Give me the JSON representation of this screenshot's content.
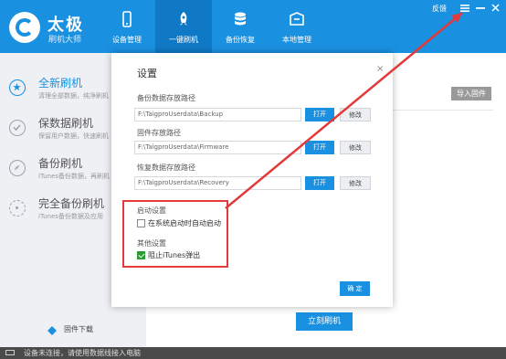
{
  "app": {
    "logo_title": "太极",
    "logo_sub": "刷机大师"
  },
  "nav": [
    {
      "label": "设备管理",
      "icon": "phone-icon"
    },
    {
      "label": "一键刷机",
      "icon": "rocket-icon"
    },
    {
      "label": "备份恢复",
      "icon": "database-icon"
    },
    {
      "label": "本地管理",
      "icon": "box-icon"
    }
  ],
  "topright": {
    "feedback": "反馈",
    "menu_icon": "menu-icon",
    "minimize_icon": "minimize-icon",
    "close_icon": "close-icon"
  },
  "sidebar": [
    {
      "title": "全新刷机",
      "desc": "清理全部数据，纯净刷机",
      "icon": "star-icon"
    },
    {
      "title": "保数据刷机",
      "desc": "保留用户数据，快速刷机",
      "icon": "check-icon"
    },
    {
      "title": "备份刷机",
      "desc": "iTunes备份数据，再刷机",
      "icon": "compass-icon"
    },
    {
      "title": "完全备份刷机",
      "desc": "iTunes备份数据及应用",
      "icon": "refresh-icon"
    }
  ],
  "sidebar_bottom": {
    "label": "固件下载"
  },
  "main": {
    "import_label": "导入固件",
    "flash_button": "立刻刷机"
  },
  "status": {
    "text": "设备未连接，请使用数据线接入电脑"
  },
  "dialog": {
    "title": "设置",
    "close": "×",
    "backup": {
      "label": "备份数据存放路径",
      "path": "F:\\TaigproUserdata\\Backup",
      "open": "打开",
      "modify": "修改"
    },
    "firmware": {
      "label": "固件存放路径",
      "path": "F:\\TaigproUserdata\\Firmware",
      "open": "打开",
      "modify": "修改"
    },
    "recovery": {
      "label": "恢复数据存放路径",
      "path": "F:\\TaigproUserdata\\Recovery",
      "open": "打开",
      "modify": "修改"
    },
    "startup": {
      "label": "启动设置",
      "option": "在系统启动时自动启动",
      "checked": false
    },
    "other": {
      "label": "其他设置",
      "option": "阻止iTunes弹出",
      "checked": true
    },
    "ok": "确 定"
  },
  "colors": {
    "brand": "#1a90e0",
    "highlight": "#e23a3a",
    "check": "#2a9a35"
  }
}
